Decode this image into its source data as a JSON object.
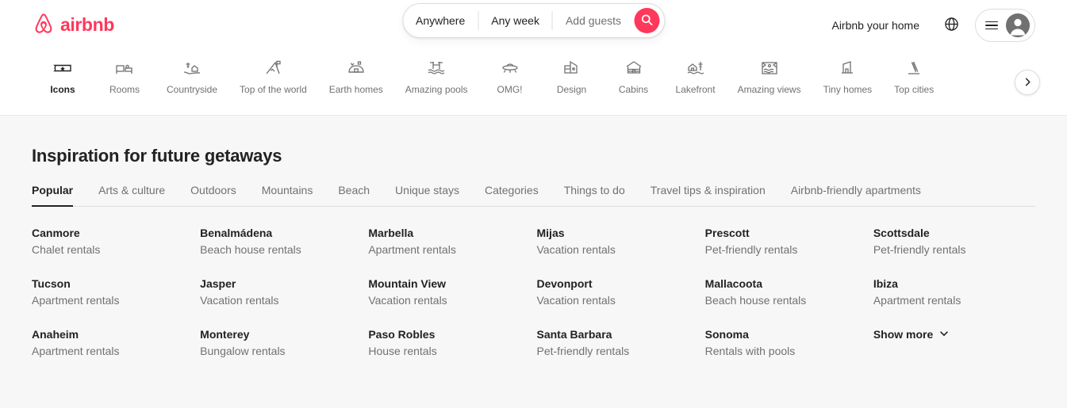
{
  "brand": {
    "name": "airbnb",
    "accent": "#FF385C"
  },
  "search": {
    "where": "Anywhere",
    "when": "Any week",
    "guests": "Add guests",
    "search_icon": "search-icon"
  },
  "header": {
    "host_link": "Airbnb your home",
    "globe_icon": "globe-icon",
    "menu_icon": "hamburger-icon",
    "avatar_icon": "user-avatar-icon"
  },
  "categories": {
    "active": "Icons",
    "next_icon": "chevron-right-icon",
    "items": [
      {
        "label": "Icons",
        "icon": "ticket-star-icon",
        "active": true
      },
      {
        "label": "Rooms",
        "icon": "bed-room-icon",
        "active": false
      },
      {
        "label": "Countryside",
        "icon": "countryside-icon",
        "active": false
      },
      {
        "label": "Top of the world",
        "icon": "mountain-flag-icon",
        "active": false
      },
      {
        "label": "Earth homes",
        "icon": "earth-home-icon",
        "active": false
      },
      {
        "label": "Amazing pools",
        "icon": "pool-icon",
        "active": false
      },
      {
        "label": "OMG!",
        "icon": "ufo-icon",
        "active": false
      },
      {
        "label": "Design",
        "icon": "design-building-icon",
        "active": false
      },
      {
        "label": "Cabins",
        "icon": "cabin-icon",
        "active": false
      },
      {
        "label": "Lakefront",
        "icon": "lakefront-icon",
        "active": false
      },
      {
        "label": "Amazing views",
        "icon": "amazing-views-icon",
        "active": false
      },
      {
        "label": "Tiny homes",
        "icon": "tiny-home-icon",
        "active": false
      },
      {
        "label": "Top cities",
        "icon": "tower-icon",
        "active": false
      }
    ]
  },
  "inspiration": {
    "title": "Inspiration for future getaways",
    "tabs": [
      {
        "label": "Popular",
        "active": true
      },
      {
        "label": "Arts & culture",
        "active": false
      },
      {
        "label": "Outdoors",
        "active": false
      },
      {
        "label": "Mountains",
        "active": false
      },
      {
        "label": "Beach",
        "active": false
      },
      {
        "label": "Unique stays",
        "active": false
      },
      {
        "label": "Categories",
        "active": false
      },
      {
        "label": "Things to do",
        "active": false
      },
      {
        "label": "Travel tips & inspiration",
        "active": false
      },
      {
        "label": "Airbnb-friendly apartments",
        "active": false
      }
    ],
    "destinations": [
      {
        "name": "Canmore",
        "sub": "Chalet rentals"
      },
      {
        "name": "Benalmádena",
        "sub": "Beach house rentals"
      },
      {
        "name": "Marbella",
        "sub": "Apartment rentals"
      },
      {
        "name": "Mijas",
        "sub": "Vacation rentals"
      },
      {
        "name": "Prescott",
        "sub": "Pet-friendly rentals"
      },
      {
        "name": "Scottsdale",
        "sub": "Pet-friendly rentals"
      },
      {
        "name": "Tucson",
        "sub": "Apartment rentals"
      },
      {
        "name": "Jasper",
        "sub": "Vacation rentals"
      },
      {
        "name": "Mountain View",
        "sub": "Vacation rentals"
      },
      {
        "name": "Devonport",
        "sub": "Vacation rentals"
      },
      {
        "name": "Mallacoota",
        "sub": "Beach house rentals"
      },
      {
        "name": "Ibiza",
        "sub": "Apartment rentals"
      },
      {
        "name": "Anaheim",
        "sub": "Apartment rentals"
      },
      {
        "name": "Monterey",
        "sub": "Bungalow rentals"
      },
      {
        "name": "Paso Robles",
        "sub": "House rentals"
      },
      {
        "name": "Santa Barbara",
        "sub": "Pet-friendly rentals"
      },
      {
        "name": "Sonoma",
        "sub": "Rentals with pools"
      }
    ],
    "show_more": "Show more",
    "show_more_icon": "chevron-down-icon"
  }
}
